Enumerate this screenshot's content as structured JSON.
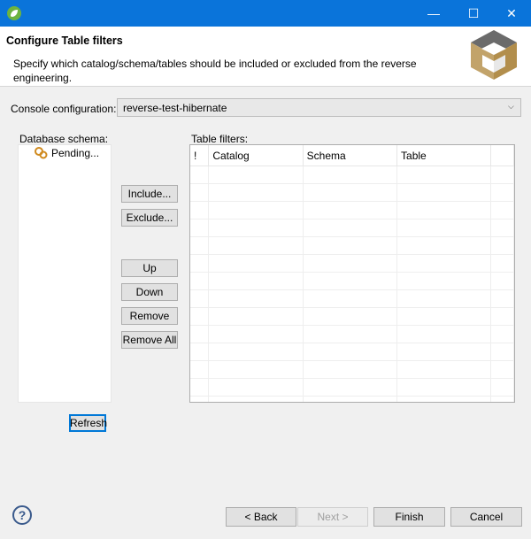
{
  "window": {
    "minimize_glyph": "—",
    "maximize_glyph": "☐",
    "close_glyph": "✕",
    "accent_color": "#0a74da"
  },
  "header": {
    "title": "Configure Table filters",
    "description": "Specify which catalog/schema/tables should be included or excluded from the reverse engineering."
  },
  "console": {
    "label": "Console configuration:",
    "selected": "reverse-test-hibernate"
  },
  "schema": {
    "label": "Database schema:",
    "items": [
      "Pending..."
    ]
  },
  "buttons": {
    "include": "Include...",
    "exclude": "Exclude...",
    "up": "Up",
    "down": "Down",
    "remove": "Remove",
    "remove_all": "Remove All",
    "refresh": "Refresh"
  },
  "filters": {
    "label": "Table filters:",
    "columns": [
      "!",
      "Catalog",
      "Schema",
      "Table"
    ],
    "rows": []
  },
  "footer": {
    "help_glyph": "?",
    "back": "< Back",
    "next": "Next >",
    "finish": "Finish",
    "cancel": "Cancel"
  }
}
